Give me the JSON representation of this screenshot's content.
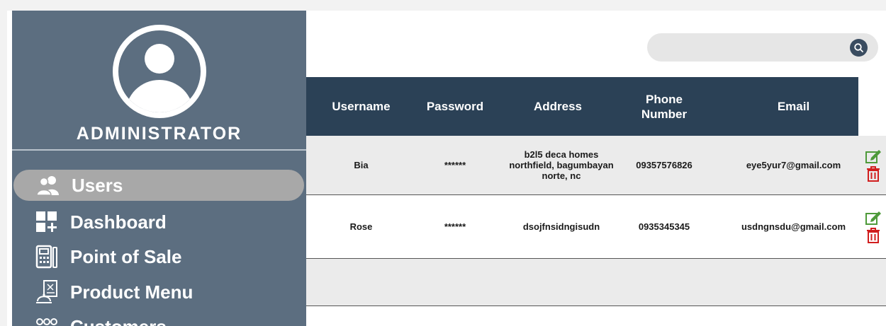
{
  "sidebar": {
    "role": "ADMINISTRATOR",
    "items": [
      {
        "label": "Users",
        "icon": "users-icon",
        "active": true
      },
      {
        "label": "Dashboard",
        "icon": "dashboard-icon"
      },
      {
        "label": "Point of Sale",
        "icon": "pos-icon"
      },
      {
        "label": "Product Menu",
        "icon": "product-menu-icon"
      },
      {
        "label": "Customers",
        "icon": "customers-icon"
      }
    ]
  },
  "search": {
    "placeholder": "",
    "icon": "search-icon"
  },
  "table": {
    "headers": [
      "Username",
      "Password",
      "Address",
      "Phone Number",
      "Email"
    ],
    "rows": [
      {
        "username": "Bia",
        "password": "******",
        "address": "b2l5 deca homes northfield, bagumbayan norte, nc",
        "phone": "09357576826",
        "email": "eye5yur7@gmail.com"
      },
      {
        "username": "Rose",
        "password": "******",
        "address": "dsojfnsidngisudn",
        "phone": "0935345345",
        "email": "usdngnsdu@gmail.com"
      }
    ],
    "edit_icon": "edit-icon",
    "delete_icon": "trash-icon"
  },
  "colors": {
    "sidebar_bg": "#5c6e80",
    "header_bg": "#2b4156",
    "active_item": "#a8a8a8",
    "edit": "#4e9a3a",
    "delete": "#d11e1e"
  }
}
